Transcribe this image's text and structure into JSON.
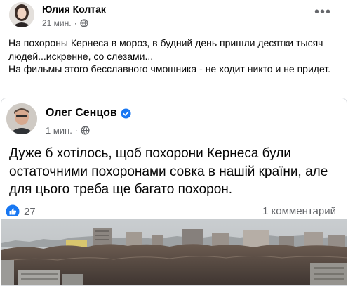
{
  "post": {
    "author": "Юлия Колтак",
    "time": "21 мин.",
    "text_lines": [
      "На похороны Кернеса в мороз, в будний день пришли десятки тысяч людей...искренне, со слезами...",
      "На фильмы этого бесславного чмошника - не ходит никто и не придет."
    ]
  },
  "shared": {
    "author": "Олег Сенцов",
    "time": "1 мин.",
    "text": "Дуже б хотілось, щоб похорони Кернеса були остаточними похоронами совка в нашій країни, але для цього треба ще багато похорон.",
    "reactions_count": "27",
    "comments_label": "1 комментарий"
  },
  "icons": {
    "more": "more-options-icon",
    "privacy": "globe-icon",
    "verified": "verified-badge-icon",
    "like": "like-reaction-icon"
  },
  "colors": {
    "like_blue": "#1877f2",
    "secondary_text": "#65676b"
  }
}
